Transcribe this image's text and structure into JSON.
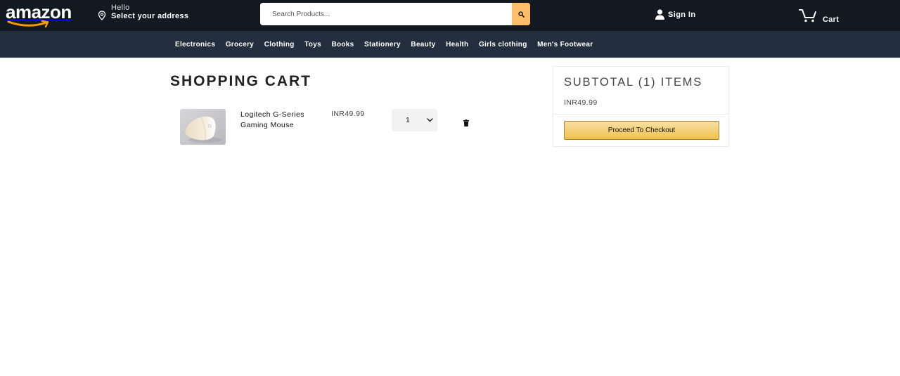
{
  "header": {
    "logo_text": "amazon",
    "address": {
      "hello": "Hello",
      "select": "Select your address",
      "icon": "location-pin-icon"
    },
    "search": {
      "placeholder": "Search Products...",
      "button_icon": "search-icon"
    },
    "signin": {
      "label": "Sign In",
      "icon": "user-icon"
    },
    "cart": {
      "label": "Cart",
      "icon": "cart-icon"
    }
  },
  "nav": {
    "items": [
      "Electronics",
      "Grocery",
      "Clothing",
      "Toys",
      "Books",
      "Stationery",
      "Beauty",
      "Health",
      "Girls clothing",
      "Men's Footwear"
    ]
  },
  "cart": {
    "title": "SHOPPING CART",
    "items": [
      {
        "name": "Logitech G-Series Gaming Mouse",
        "price": "INR49.99",
        "quantity": "1"
      }
    ]
  },
  "subtotal": {
    "title": "SUBTOTAL (1) ITEMS",
    "value": "INR49.99",
    "checkout_label": "Proceed To Checkout"
  },
  "colors": {
    "topbar": "#131921",
    "navbar": "#232f3e",
    "search_button": "#febd69",
    "checkout_button": "#f0c14b"
  }
}
